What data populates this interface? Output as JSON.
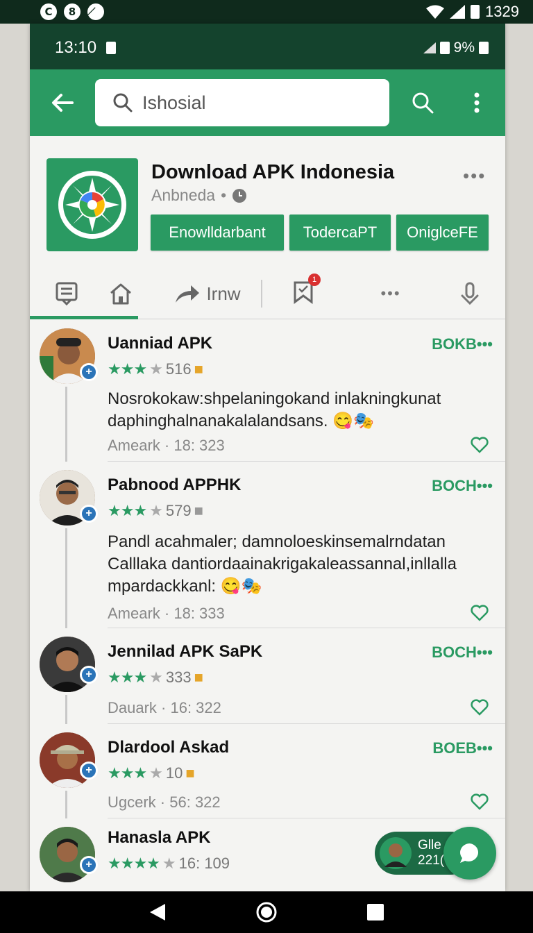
{
  "system_bar": {
    "time": "1329",
    "left_icons": [
      "C",
      "8",
      "̸"
    ]
  },
  "device_bar": {
    "time": "13:10",
    "battery": "9%"
  },
  "search": {
    "value": "Ishosial"
  },
  "app": {
    "title": "Download APK Indonesia",
    "developer": "Anbneda",
    "chips": [
      "Enowlldarbant",
      "TodercaPT",
      "OniglceFE"
    ]
  },
  "tabs": {
    "share_label": "Irnw",
    "badge": "1"
  },
  "items": [
    {
      "name": "Uanniad APK",
      "rating": "516",
      "badge_label": "BOKB",
      "body": "Nosrokokaw:shpelaningokand inlakningkunat daphinghalnanakalalandsans. 😋🎭",
      "meta_user": "Ameark",
      "meta_time": "18: 323"
    },
    {
      "name": "Pabnood APPHK",
      "rating": "579",
      "badge_label": "BOCH",
      "body": "Pandl acahmaler; damnoloeskinsemalrndatan Calllaka dantiordaainakrigakaleassannal,inllalla mpardackkanl: 😋🎭",
      "meta_user": "Ameark",
      "meta_time": "18: 333"
    },
    {
      "name": "Jennilad APK SaPK",
      "rating": "333",
      "badge_label": "BOCH",
      "body": "",
      "meta_user": "Dauark",
      "meta_time": "16: 322"
    },
    {
      "name": "Dlardool Askad",
      "rating": "10",
      "badge_label": "BOEB",
      "body": "",
      "meta_user": "Ugcerk",
      "meta_time": "56: 322"
    },
    {
      "name": "Hanasla APK",
      "rating": "16: 109",
      "badge_label": "",
      "body": "",
      "meta_user": "",
      "meta_time": ""
    }
  ],
  "chat": {
    "line1": "Glle",
    "line2": "221("
  },
  "colors": {
    "primary": "#2a9a62",
    "dark": "#14432d",
    "accent": "#2b74b8"
  }
}
